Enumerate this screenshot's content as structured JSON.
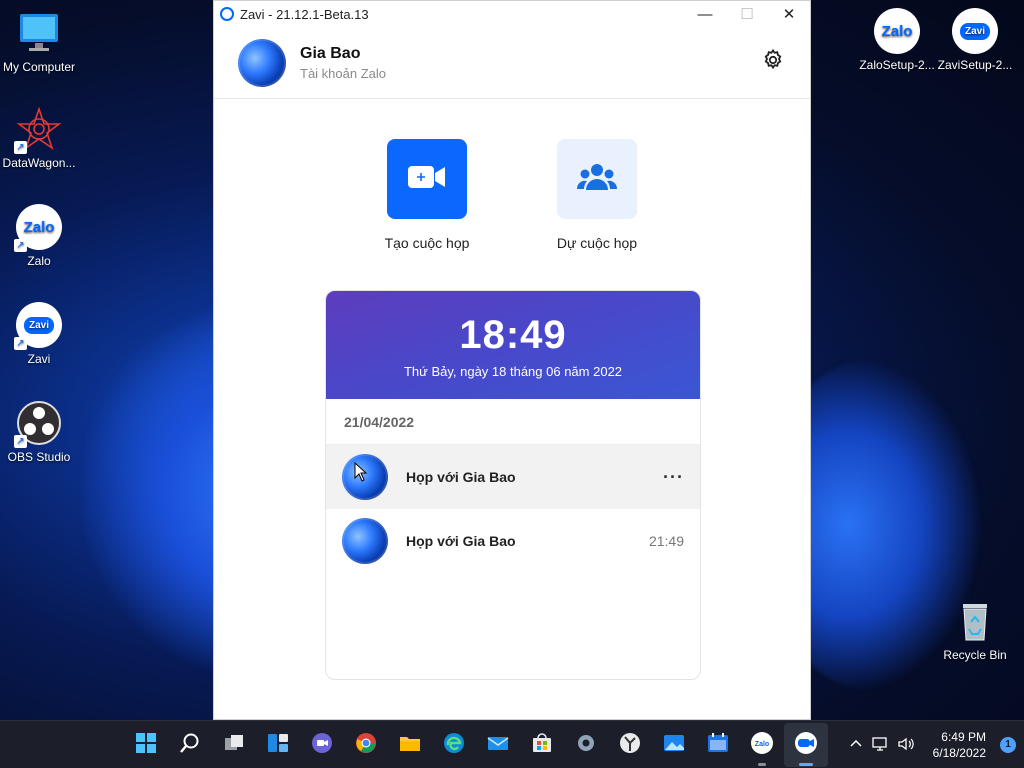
{
  "desktop": {
    "icons_left": [
      {
        "label": "My Computer",
        "icon": "computer-monitor-icon"
      },
      {
        "label": "DataWagon...",
        "icon": "datawagon-icon"
      },
      {
        "label": "Zalo",
        "icon": "zalo-icon"
      },
      {
        "label": "Zavi",
        "icon": "zavi-icon"
      },
      {
        "label": "OBS Studio",
        "icon": "obs-icon"
      }
    ],
    "icons_right": [
      {
        "label": "ZaloSetup-2...",
        "icon": "zalo-icon"
      },
      {
        "label": "ZaviSetup-2...",
        "icon": "zavi-icon"
      }
    ],
    "recycle_bin": {
      "label": "Recycle Bin",
      "icon": "recycle-bin-icon"
    }
  },
  "window": {
    "title": "Zavi - 21.12.1-Beta.13",
    "controls": {
      "minimize": "—",
      "maximize": "☐",
      "close": "✕"
    }
  },
  "profile": {
    "name": "Gia Bao",
    "account": "Tài khoản Zalo"
  },
  "actions": {
    "create_label": "Tạo cuộc họp",
    "join_label": "Dự cuộc họp"
  },
  "schedule": {
    "time": "18:49",
    "date": "Thứ Bảy, ngày 18 tháng 06 năm 2022",
    "group_date": "21/04/2022",
    "meetings": [
      {
        "title": "Họp với Gia Bao",
        "time": "",
        "more": "···"
      },
      {
        "title": "Họp với Gia Bao",
        "time": "21:49",
        "more": ""
      }
    ]
  },
  "taskbar": {
    "apps": [
      "start-icon",
      "search-icon",
      "task-view-icon",
      "widgets-icon",
      "teams-chat-icon",
      "chrome-icon",
      "file-explorer-icon",
      "edge-icon",
      "mail-icon",
      "store-icon",
      "settings-icon",
      "clock-app-icon",
      "photos-icon",
      "calendar-icon",
      "zalo-icon",
      "zavi-icon"
    ],
    "time": "6:49 PM",
    "date": "6/18/2022",
    "notification_count": "1"
  },
  "colors": {
    "accent": "#0a68ff",
    "tile_secondary": "#eaf1fe",
    "card_gradient_start": "#5d3dbd",
    "card_gradient_end": "#3a57d4"
  }
}
